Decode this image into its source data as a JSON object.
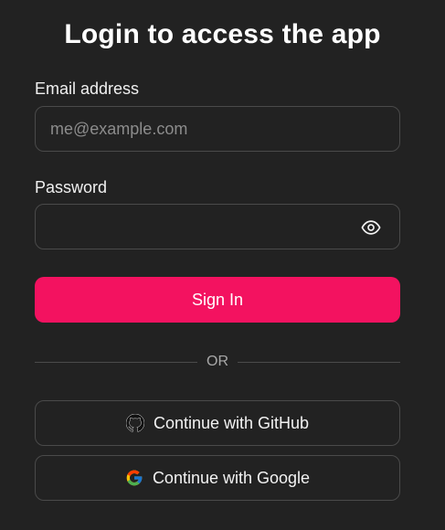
{
  "heading": "Login to access the app",
  "email": {
    "label": "Email address",
    "placeholder": "me@example.com",
    "value": ""
  },
  "password": {
    "label": "Password",
    "value": "",
    "toggle_icon": "eye-icon"
  },
  "sign_in_label": "Sign In",
  "divider_text": "OR",
  "oauth": {
    "github_label": "Continue with GitHub",
    "github_icon": "github-icon",
    "google_label": "Continue with Google",
    "google_icon": "google-icon"
  },
  "colors": {
    "background": "#222222",
    "primary": "#f31260",
    "border": "#4a4a4a",
    "text": "#f2f2f2",
    "muted": "#a8a8a8"
  }
}
